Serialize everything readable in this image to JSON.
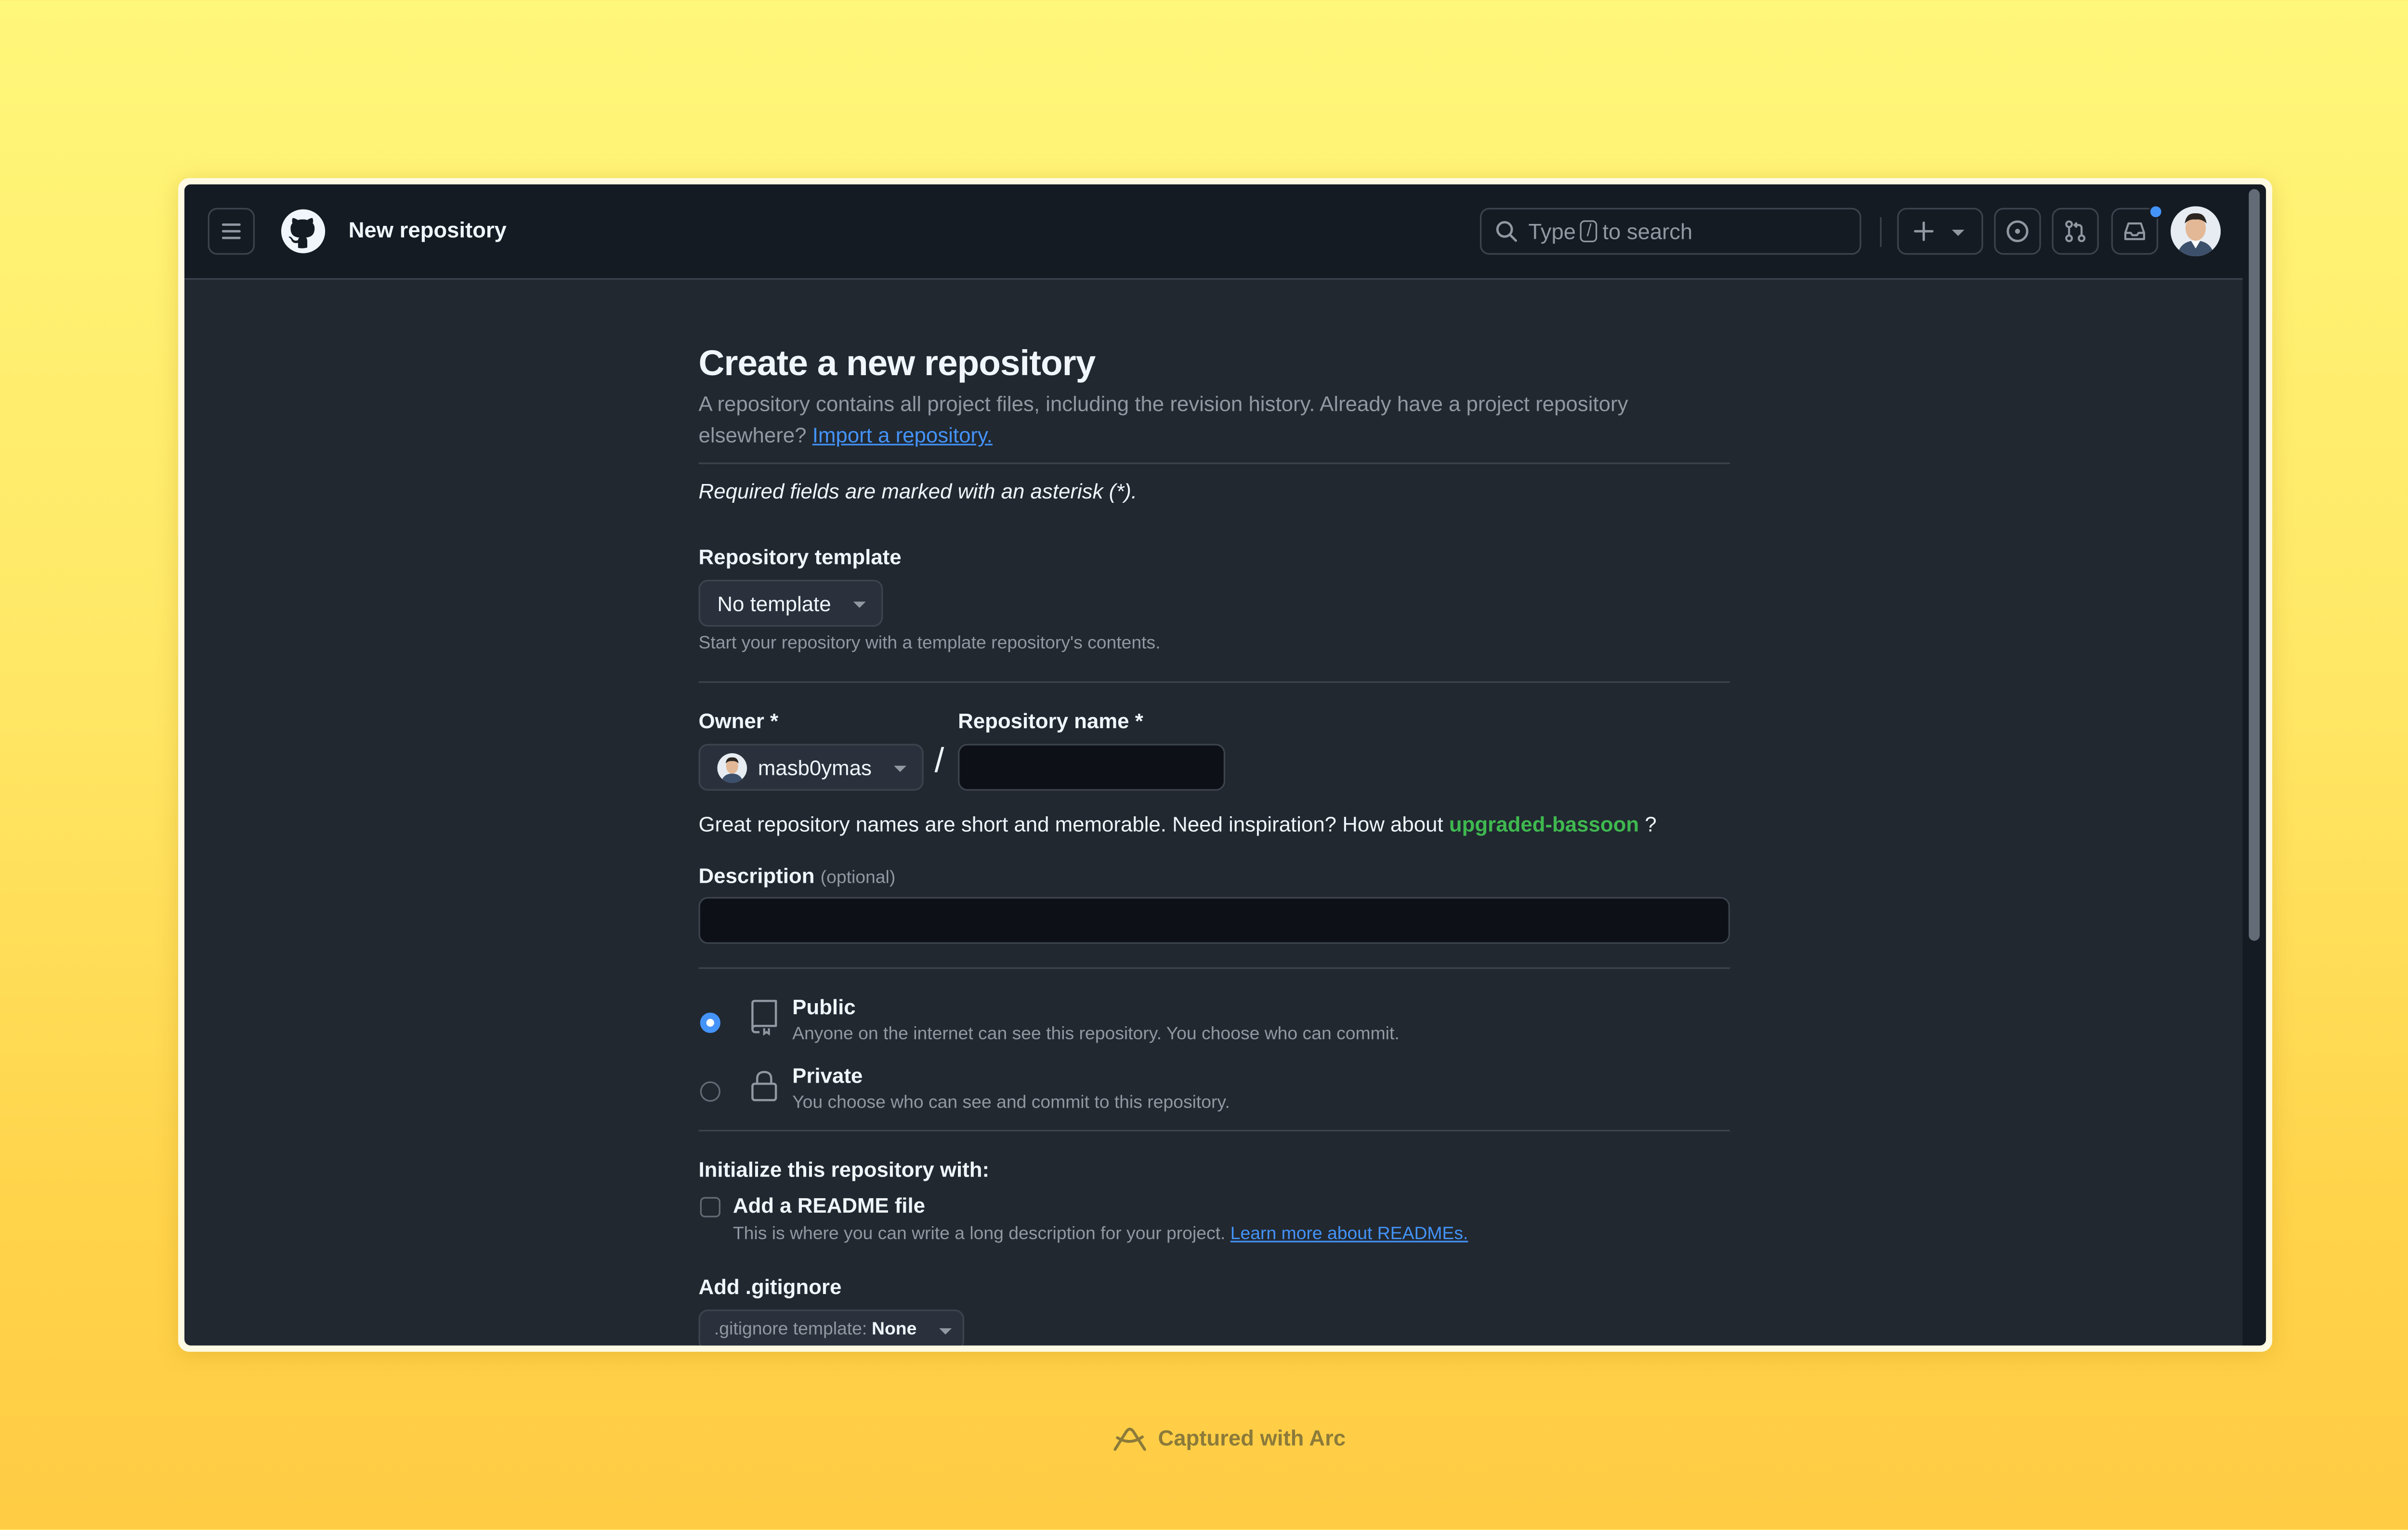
{
  "nav": {
    "title": "New repository",
    "search": {
      "prefix": "Type",
      "key": "/",
      "suffix": "to search"
    }
  },
  "page": {
    "heading": "Create a new repository",
    "lead_text": "A repository contains all project files, including the revision history. Already have a project repository elsewhere?",
    "import_link": "Import a repository.",
    "required_note": "Required fields are marked with an asterisk (*)."
  },
  "template": {
    "label": "Repository template",
    "button": "No template",
    "help": "Start your repository with a template repository's contents."
  },
  "owner": {
    "label": "Owner *",
    "value": "masb0ymas"
  },
  "separator": "/",
  "repo_name": {
    "label": "Repository name *",
    "value": ""
  },
  "inspiration": {
    "text": "Great repository names are short and memorable. Need inspiration? How about",
    "suggestion": "upgraded-bassoon",
    "end": "?"
  },
  "description": {
    "label": "Description",
    "optional": "(optional)",
    "value": ""
  },
  "visibility": {
    "selected": "public",
    "public": {
      "title": "Public",
      "desc": "Anyone on the internet can see this repository. You choose who can commit."
    },
    "private": {
      "title": "Private",
      "desc": "You choose who can see and commit to this repository."
    }
  },
  "init": {
    "heading": "Initialize this repository with:",
    "readme": {
      "label": "Add a README file",
      "checked": false,
      "desc": "This is where you can write a long description for your project.",
      "link": "Learn more about READMEs."
    }
  },
  "gitignore": {
    "label": "Add .gitignore",
    "prefix": ".gitignore template:",
    "value": "None"
  },
  "footer": {
    "text": "Captured with Arc"
  },
  "colors": {
    "background": "#212830",
    "header": "#151b23",
    "accent": "#4493f8",
    "success": "#3fb950",
    "text": "#f0f6fc",
    "muted": "#9198a1"
  }
}
